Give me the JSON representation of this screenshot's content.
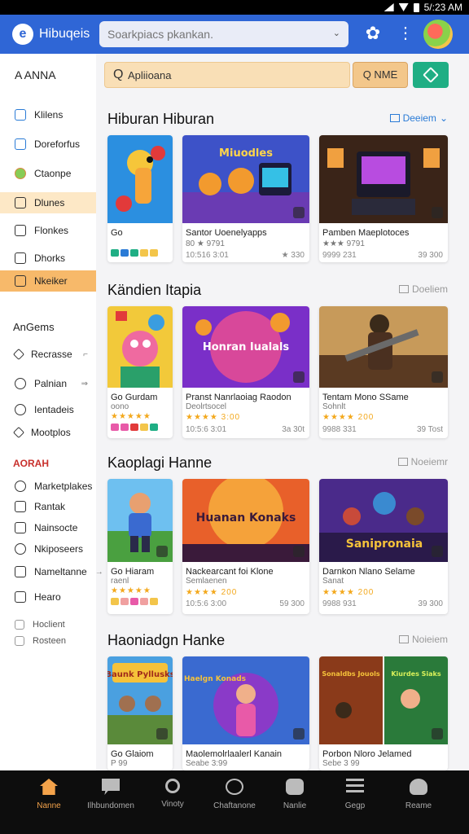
{
  "status_bar": {
    "time": "5/:23 AM"
  },
  "app_bar": {
    "logo_letter": "e",
    "app_name": "Hibuqeis",
    "search_placeholder": "Soarkpiacs pkankan.",
    "search_chevron": "⌄"
  },
  "sidebar": {
    "title": "A  ANNA",
    "items": [
      {
        "label": "Klilens"
      },
      {
        "label": "Doreforfus"
      },
      {
        "label": "Ctaonpe"
      },
      {
        "label": "Dlunes"
      },
      {
        "label": "Flonkes"
      },
      {
        "label": "Dhorks"
      },
      {
        "label": "Nkeiker"
      }
    ],
    "section2_title": "AnGems",
    "section2_items": [
      {
        "label": "Recrasse",
        "arrow": "⌐"
      },
      {
        "label": "Palnian",
        "arrow": "⇒"
      },
      {
        "label": "Ientadeis"
      },
      {
        "label": "Mootplos"
      }
    ],
    "section3_title": "AORAH",
    "section3_items": [
      {
        "label": "Marketplakes"
      },
      {
        "label": "Rantak"
      },
      {
        "label": "Nainsocte"
      },
      {
        "label": "Nkiposeers"
      },
      {
        "label": "Nameltanne",
        "arrow": "→"
      },
      {
        "label": "Hearo"
      }
    ],
    "section4_items": [
      {
        "label": "Hoclient"
      },
      {
        "label": "Rosteen"
      }
    ]
  },
  "toolbar": {
    "search_icon_glyph": "Q",
    "search_text": "Apliioana",
    "filter_label": "Q NME"
  },
  "sections": [
    {
      "title": "Hiburan Hiburan",
      "link": "Deeiem",
      "cards": [
        {
          "name": "Go",
          "sub": "",
          "meta": "",
          "meta2": ""
        },
        {
          "name": "Santor Uoenelyapps",
          "sub": "80 ★ 9791",
          "meta": "10:516 3:01",
          "meta2": "★ 330"
        },
        {
          "name": "Pamben Maeplotoces",
          "sub": "★★★ 9791",
          "meta": "9999 231",
          "meta2": "39 300"
        }
      ]
    },
    {
      "title": "Kändien Itapia",
      "link": "Doeliem",
      "cards": [
        {
          "name": "Go  Gurdam",
          "sub": "oono",
          "meta": "",
          "meta2": ""
        },
        {
          "name": "Pranst Nanrlaoiag Raodon",
          "sub": "Deolrtsocel",
          "stars": "★★★★ 3:00",
          "meta": "10:5:6 3:01",
          "meta2": "3a 30t"
        },
        {
          "name": "Tentam Mono SSame",
          "sub": "Sohnlt",
          "stars": "★★★★ 200",
          "meta": "9988 331",
          "meta2": "39 Tost"
        }
      ]
    },
    {
      "title": "Kaoplagi Hanne",
      "link": "Noeiemr",
      "cards": [
        {
          "name": "Go  Hiaram",
          "sub": "raenl",
          "meta": "",
          "meta2": ""
        },
        {
          "name": "Nackearcant foi Klone",
          "sub": "Semlaenen",
          "stars": "★★★★ 200",
          "meta": "10:5:6 3:00",
          "meta2": "59 300"
        },
        {
          "name": "Darnkon Nlano Selame",
          "sub": "Sanat",
          "stars": "★★★★ 200",
          "meta": "9988 931",
          "meta2": "39 300"
        }
      ]
    },
    {
      "title": "Haoniadgn Hanke",
      "link": "Noieiem",
      "cards": [
        {
          "name": "Go  Glaiom",
          "sub": "P 99",
          "meta": "",
          "meta2": ""
        },
        {
          "name": "Maolemolrlaalerl Kanain",
          "sub": "Seabe 3:99",
          "meta": "",
          "meta2": ""
        },
        {
          "name": "Porbon Nloro Jelamed",
          "sub": "Sebe 3 99",
          "meta": "",
          "meta2": ""
        }
      ]
    }
  ],
  "cover_texts": {
    "c1": "Miuodles",
    "c4": "Honran Iualals",
    "c7": "Huanan Konaks",
    "c8": "Sanipronaia",
    "c9": "Baunk Pyllusks",
    "c10": "Haelgn Konads",
    "c11": "Sonaldbs Jouols",
    "c11b": "Kiurdes Siaks"
  },
  "bottom_nav": [
    {
      "label": "Nanne",
      "icon": "home-icon",
      "active": true
    },
    {
      "label": "Ilhbundomen",
      "icon": "chat-icon"
    },
    {
      "label": "Vinoty",
      "icon": "search-icon"
    },
    {
      "label": "Chaftanone",
      "icon": "compass-icon"
    },
    {
      "label": "Nanlie",
      "icon": "gamepad-icon"
    },
    {
      "label": "Gegp",
      "icon": "menu-icon"
    },
    {
      "label": "Reame",
      "icon": "profile-icon"
    }
  ],
  "colors": {
    "app_bar": "#2f66d6",
    "accent_orange": "#f3a24a",
    "accent_green": "#1fae84",
    "link_blue": "#2a7bd6"
  }
}
